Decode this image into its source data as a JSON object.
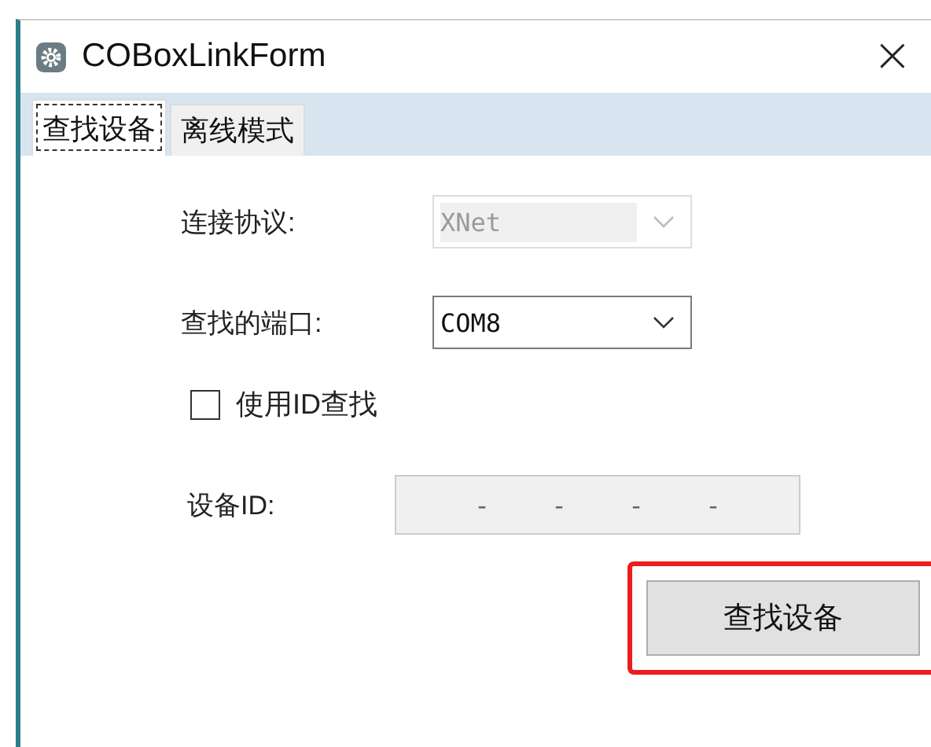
{
  "window": {
    "title": "COBoxLinkForm",
    "close": "×"
  },
  "tabs": [
    {
      "label": "查找设备",
      "selected": true
    },
    {
      "label": "离线模式",
      "selected": false
    }
  ],
  "fields": [
    {
      "label": "连接协议:",
      "value": "XNet",
      "disabled": true
    },
    {
      "label": "查找的端口:",
      "value": "COM8",
      "disabled": false
    }
  ],
  "checkbox": {
    "label": "使用ID查找",
    "checked": false
  },
  "device_id": {
    "label": "设备ID:",
    "segments": [
      "-",
      "-",
      "-",
      "-"
    ]
  },
  "button": {
    "label": "查找设备",
    "highlighted": true
  }
}
